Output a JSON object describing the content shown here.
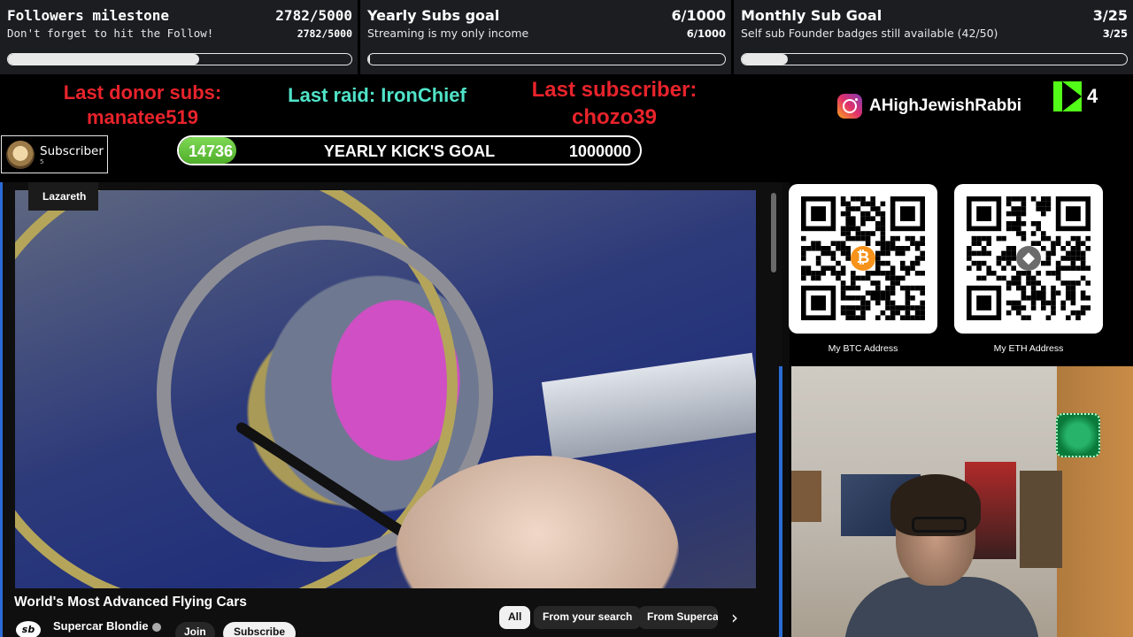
{
  "goals": [
    {
      "title": "Followers milestone",
      "count": "2782/5000",
      "subtitle": "Don't forget to hit the Follow!",
      "count_small": "2782/5000",
      "progress": 0.556
    },
    {
      "title": "Yearly Subs goal",
      "count": "6/1000",
      "subtitle": "Streaming is my only income",
      "count_small": "6/1000",
      "progress": 0.006
    },
    {
      "title": "Monthly Sub Goal",
      "count": "3/25",
      "subtitle": "Self sub Founder badges still available (42/50)",
      "count_small": "3/25",
      "progress": 0.12
    }
  ],
  "events": {
    "donor_label": "Last donor subs:",
    "donor_name": "manatee519",
    "raid": "Last raid: IronChief",
    "sub_label": "Last subscriber:",
    "sub_name": "chozo39"
  },
  "instagram": {
    "handle": "AHighJewishRabbi"
  },
  "kick": {
    "count": "4"
  },
  "subscriber_badge": {
    "title": "Subscriber",
    "small": "5"
  },
  "kick_goal": {
    "current": "14736",
    "label": "YEARLY KICK'S GOAL",
    "target": "1000000",
    "progress": 0.0147
  },
  "youtube": {
    "overlay_label": "Lazareth",
    "title": "World's Most Advanced Flying Cars",
    "channel": "Supercar Blondie",
    "channel_logo": "sb",
    "join": "Join",
    "subscribe": "Subscribe",
    "chips": [
      "All",
      "From your search",
      "From Supercar"
    ],
    "next_icon": "chevron-right-icon"
  },
  "qr": [
    {
      "caption": "My BTC Address",
      "coin": "₿",
      "coin_color": "#f7931a"
    },
    {
      "caption": "My ETH Address",
      "coin": "◆",
      "coin_color": "#6b6b6b"
    }
  ]
}
